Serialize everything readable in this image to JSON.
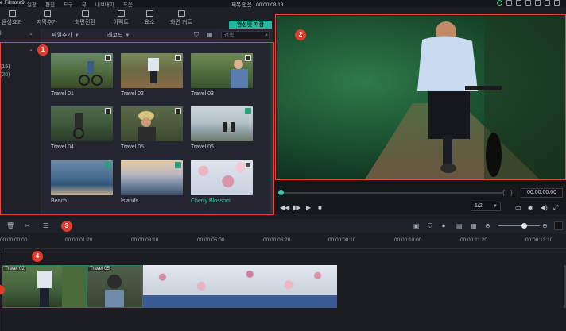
{
  "titlebar": {
    "app_name": "e Filmora9",
    "menu": [
      "일정",
      "편집",
      "도구",
      "뷰",
      "내보내기",
      "도움"
    ],
    "center_title": "제목 없음 : 00:00:08:18"
  },
  "toolbar": {
    "tabs": [
      {
        "label": "음성효과",
        "icon": "audio-icon"
      },
      {
        "label": "자막추가",
        "icon": "title-icon"
      },
      {
        "label": "화면전환",
        "icon": "transition-icon"
      },
      {
        "label": "이펙트",
        "icon": "effects-icon"
      },
      {
        "label": "요소",
        "icon": "elements-icon"
      },
      {
        "label": "화면 커트",
        "icon": "split-screen-icon"
      }
    ],
    "save_label": "완성및 저장"
  },
  "sidebar": {
    "rows": [
      {
        "label": "l"
      },
      {
        "label": "(15)"
      },
      {
        "label": "(20)"
      }
    ]
  },
  "media": {
    "import_label": "파일추가",
    "record_label": "레코드",
    "search_placeholder": "검색",
    "items": [
      {
        "label": "Travel 01",
        "badge": "grid"
      },
      {
        "label": "Travel 02",
        "badge": "grid"
      },
      {
        "label": "Travel 03",
        "badge": "grid"
      },
      {
        "label": "Travel 04",
        "badge": "grid"
      },
      {
        "label": "Travel 05",
        "badge": "grid"
      },
      {
        "label": "Travel 06",
        "badge": "download"
      },
      {
        "label": "Beach",
        "badge": "download"
      },
      {
        "label": "Islands",
        "badge": "download"
      },
      {
        "label": "Cherry Blossom",
        "badge": "grid",
        "highlight": true
      }
    ]
  },
  "preview": {
    "timecode": "00:00:00:00",
    "ratio": "1/2"
  },
  "markers": [
    "1",
    "2",
    "3",
    "4"
  ],
  "ruler": {
    "timecodes": [
      "00:00:00:00",
      "00:00:01:20",
      "00:00:03:10",
      "00:00:05:00",
      "00:00:06:20",
      "00:00:08:10",
      "00:00:10:00",
      "00:00:11:20",
      "00:00:13:10"
    ]
  },
  "tracks": {
    "clips": [
      {
        "label": "Travel 02"
      },
      {
        "label": "Travel 05"
      },
      {
        "label": ""
      }
    ]
  },
  "colors": {
    "accent": "#1fb89c",
    "marker": "#e13b2d",
    "frame": "#e5473b",
    "clip_bar": "#3a5b93"
  }
}
